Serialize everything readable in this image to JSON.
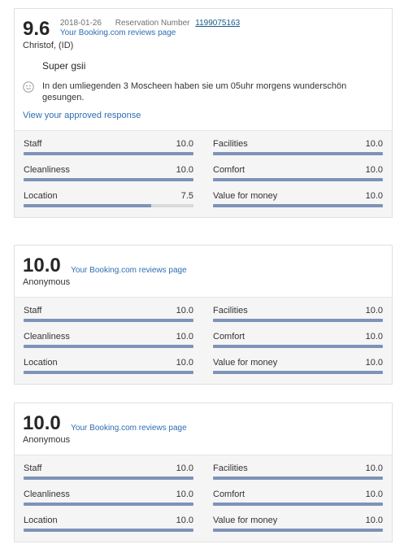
{
  "reviews": [
    {
      "score": "9.6",
      "date": "2018-01-26",
      "reservation_label": "Reservation Number",
      "reservation_number": "1199075163",
      "reviews_link": "Your Booking.com reviews page",
      "reviewer": "Christof, (ID)",
      "title": "Super gsii",
      "comment": "In den umliegenden 3 Moscheen haben sie um 05uhr morgens wunderschön gesungen.",
      "response_link": "View your approved response",
      "metrics": [
        {
          "label": "Staff",
          "value": "10.0",
          "fraction": 1.0
        },
        {
          "label": "Facilities",
          "value": "10.0",
          "fraction": 1.0
        },
        {
          "label": "Cleanliness",
          "value": "10.0",
          "fraction": 1.0
        },
        {
          "label": "Comfort",
          "value": "10.0",
          "fraction": 1.0
        },
        {
          "label": "Location",
          "value": "7.5",
          "fraction": 0.75
        },
        {
          "label": "Value for money",
          "value": "10.0",
          "fraction": 1.0
        }
      ]
    },
    {
      "score": "10.0",
      "reviews_link": "Your Booking.com reviews page",
      "reviewer": "Anonymous",
      "metrics": [
        {
          "label": "Staff",
          "value": "10.0",
          "fraction": 1.0
        },
        {
          "label": "Facilities",
          "value": "10.0",
          "fraction": 1.0
        },
        {
          "label": "Cleanliness",
          "value": "10.0",
          "fraction": 1.0
        },
        {
          "label": "Comfort",
          "value": "10.0",
          "fraction": 1.0
        },
        {
          "label": "Location",
          "value": "10.0",
          "fraction": 1.0
        },
        {
          "label": "Value for money",
          "value": "10.0",
          "fraction": 1.0
        }
      ]
    },
    {
      "score": "10.0",
      "reviews_link": "Your Booking.com reviews page",
      "reviewer": "Anonymous",
      "metrics": [
        {
          "label": "Staff",
          "value": "10.0",
          "fraction": 1.0
        },
        {
          "label": "Facilities",
          "value": "10.0",
          "fraction": 1.0
        },
        {
          "label": "Cleanliness",
          "value": "10.0",
          "fraction": 1.0
        },
        {
          "label": "Comfort",
          "value": "10.0",
          "fraction": 1.0
        },
        {
          "label": "Location",
          "value": "10.0",
          "fraction": 1.0
        },
        {
          "label": "Value for money",
          "value": "10.0",
          "fraction": 1.0
        }
      ]
    }
  ],
  "colors": {
    "bar_fill": "#7d93b8",
    "bar_track": "#d9d9d9",
    "link": "#2f6db1"
  },
  "icons": {
    "comment_positive": "smiley-icon"
  }
}
